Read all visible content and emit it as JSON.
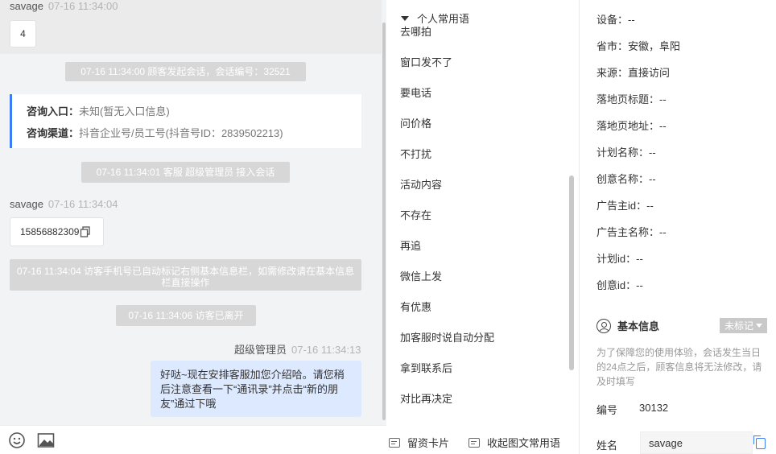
{
  "chat": {
    "msg1": {
      "sender": "savage",
      "time": "07-16 11:34:00",
      "text": "4"
    },
    "sys1": "07-16 11:34:00 顾客发起会话，会话编号：32521",
    "entry": {
      "entry_label": "咨询入口：",
      "entry_value": "未知(暂无入口信息)",
      "channel_label": "咨询渠道：",
      "channel_value": "抖音企业号/员工号(抖音号ID：2839502213)"
    },
    "sys2": "07-16 11:34:01 客服 超级管理员 接入会话",
    "msg2": {
      "sender": "savage",
      "time": "07-16 11:34:04",
      "text": "15856882309"
    },
    "sys3": "07-16 11:34:04 访客手机号已自动标记右侧基本信息栏，如需修改请在基本信息栏直接操作",
    "sys4": "07-16 11:34:06 访客已离开",
    "msg3": {
      "sender": "超级管理员",
      "time": "07-16 11:34:13",
      "text": "好哒~现在安排客服加您介绍哈。请您稍后注意查看一下“通讯录”并点击“新的朋友”通过下哦"
    }
  },
  "toolbar": {
    "emoji_icon": "smile-icon",
    "image_icon": "image-icon"
  },
  "phrases": {
    "header": "个人常用语",
    "items": [
      "去哪拍",
      "窗口发不了",
      "要电话",
      "问价格",
      "不打扰",
      "活动内容",
      "不存在",
      "再追",
      "微信上发",
      "有优惠",
      "加客服时说自动分配",
      "拿到联系后",
      "对比再决定"
    ],
    "footer_card": "留资卡片",
    "footer_collapse": "收起图文常用语"
  },
  "info": {
    "rows": [
      "设备：--",
      "省市：安徽，阜阳",
      "来源：直接访问",
      "落地页标题：--",
      "落地页地址：--",
      "计划名称：--",
      "创意名称：--",
      "广告主id：--",
      "广告主名称：--",
      "计划id：--",
      "创意id：--"
    ],
    "basic_title": "基本信息",
    "tag": "未标记",
    "notice": "为了保障您的使用体验，会话发生当日的24点之后，顾客信息将无法修改，请及时填写",
    "id_label": "编号",
    "id_value": "30132",
    "name_label": "姓名",
    "name_value": "savage"
  },
  "colors": {
    "accent": "#3b7cf7",
    "agent_bubble": "#dde9ff",
    "system_notice": "#d7d7d7"
  }
}
